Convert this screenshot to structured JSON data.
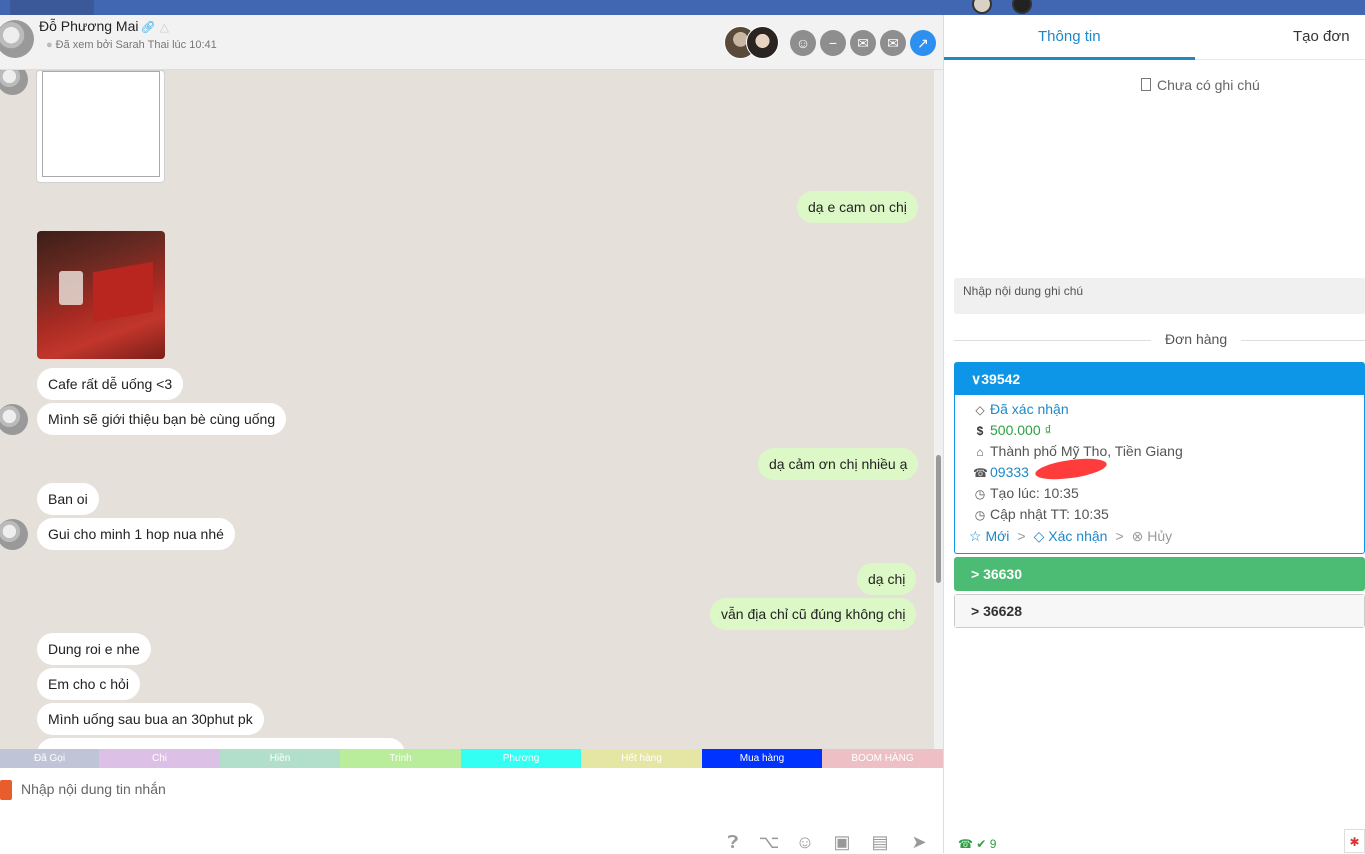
{
  "header": {
    "contact_name": "Đỗ Phương Mai",
    "seen_text": "Đã xem bởi Sarah Thai lúc 10:41",
    "buttons": [
      "reddit-icon",
      "minus-icon",
      "inbox-icon",
      "mail-icon",
      "arrow-up-right-icon"
    ]
  },
  "messages": [
    {
      "dir": "out",
      "text": "dạ e cam on chị"
    },
    {
      "dir": "in",
      "text": "Cafe rất dễ uống <3"
    },
    {
      "dir": "in",
      "text": "Mình sẽ giới thiệu bạn bè cùng uống"
    },
    {
      "dir": "out",
      "text": "dạ cảm ơn chị nhiều ạ"
    },
    {
      "dir": "in",
      "text": "Ban oi"
    },
    {
      "dir": "in",
      "text": "Gui cho minh 1 hop nua nhé"
    },
    {
      "dir": "out",
      "text": "dạ chị"
    },
    {
      "dir": "out",
      "text": "vẫn địa chỉ cũ đúng không chị"
    },
    {
      "dir": "in",
      "text": "Dung roi e nhe"
    },
    {
      "dir": "in",
      "text": "Em cho c hỏi"
    },
    {
      "dir": "in",
      "text": "Mình uống sau bua an 30phut pk"
    }
  ],
  "tags": [
    {
      "label": "Đã Gọi",
      "color": "#bfc4d6"
    },
    {
      "label": "Chi",
      "color": "#dcc0e6"
    },
    {
      "label": "Hiền",
      "color": "#b2dfcc"
    },
    {
      "label": "Trinh",
      "color": "#b9ec9b"
    },
    {
      "label": "Phương",
      "color": "#33fff2"
    },
    {
      "label": "Hết hàng",
      "color": "#e5e6a3"
    },
    {
      "label": "Mua hàng",
      "color": "#0033ff"
    },
    {
      "label": "BOOM HÀNG",
      "color": "#eec0c5"
    }
  ],
  "composer": {
    "placeholder": "Nhập nội dung tin nhắn"
  },
  "right_panel": {
    "tabs": [
      "Thông tin",
      "Tạo đơn"
    ],
    "note_empty": "Chưa có ghi chú",
    "note_placeholder": "Nhập nội dung ghi chú",
    "orders_title": "Đơn hàng",
    "orders": [
      {
        "id": "39542",
        "color": "#0d95e8",
        "expanded": true,
        "status": "Đã xác nhận",
        "price": "500.000 ₫",
        "address": "Thành phố Mỹ Tho, Tiền Giang",
        "phone": "09333",
        "created": "Tạo lúc: 10:35",
        "updated": "Cập nhật TT: 10:35",
        "flow": [
          "Mới",
          "Xác nhận",
          "Hủy"
        ]
      },
      {
        "id": "36630",
        "color": "#4cbb73",
        "expanded": false
      },
      {
        "id": "36628",
        "color": "#f7f7f7",
        "expanded": false
      }
    ],
    "bottom_count": "9"
  }
}
